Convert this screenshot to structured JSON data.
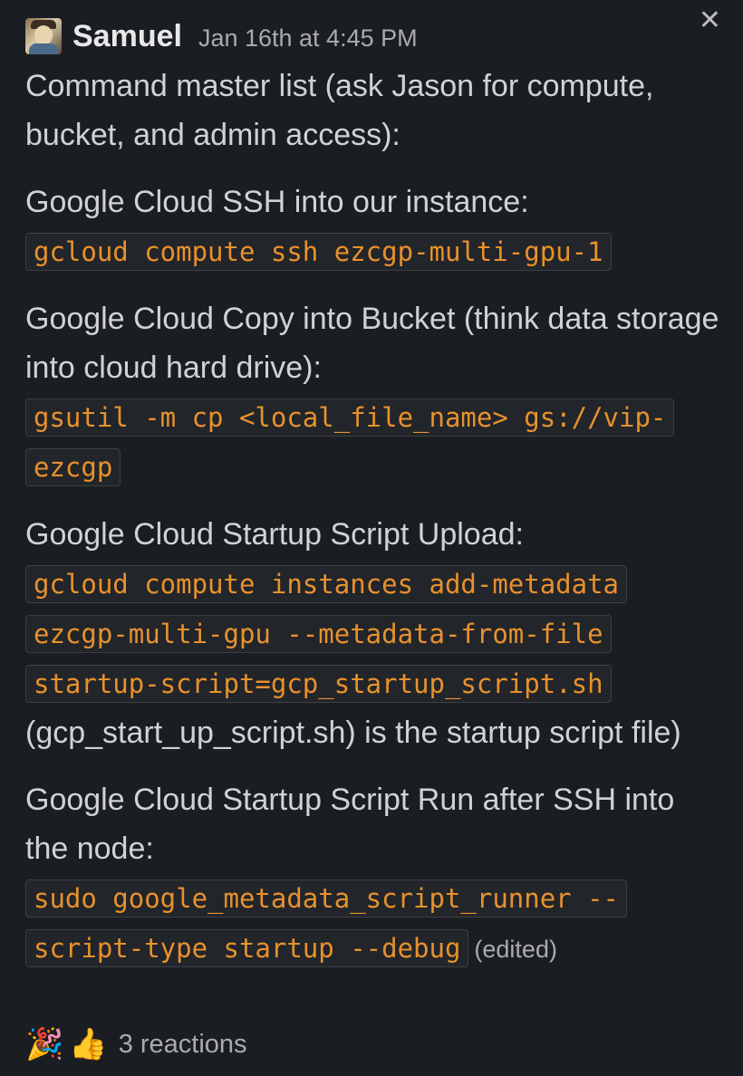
{
  "message": {
    "sender": "Samuel",
    "timestamp": "Jan 16th at 4:45 PM",
    "intro": "Command master list (ask Jason for compute, bucket, and admin access):",
    "sections": [
      {
        "label": "Google Cloud SSH into our instance:",
        "code": "gcloud compute ssh ezcgp-multi-gpu-1"
      },
      {
        "label": "Google Cloud Copy into Bucket (think data storage into cloud hard drive):",
        "code": "gsutil -m cp <local_file_name> gs://vip-ezcgp"
      },
      {
        "label": "Google Cloud Startup Script Upload:",
        "code": "gcloud compute instances add-metadata ezcgp-multi-gpu --metadata-from-file startup-script=gcp_startup_script.sh",
        "note": "(gcp_start_up_script.sh) is the startup script file)"
      },
      {
        "label": "Google Cloud Startup Script Run after SSH into the node:",
        "code": "sudo google_metadata_script_runner --script-type startup --debug",
        "edited": "(edited)"
      }
    ]
  },
  "reactions": {
    "emojis": [
      "party-popper-icon",
      "thumbs-up-icon"
    ],
    "glyphs": [
      "🎉",
      "👍"
    ],
    "count_label": "3 reactions"
  },
  "close_glyph": "✕"
}
